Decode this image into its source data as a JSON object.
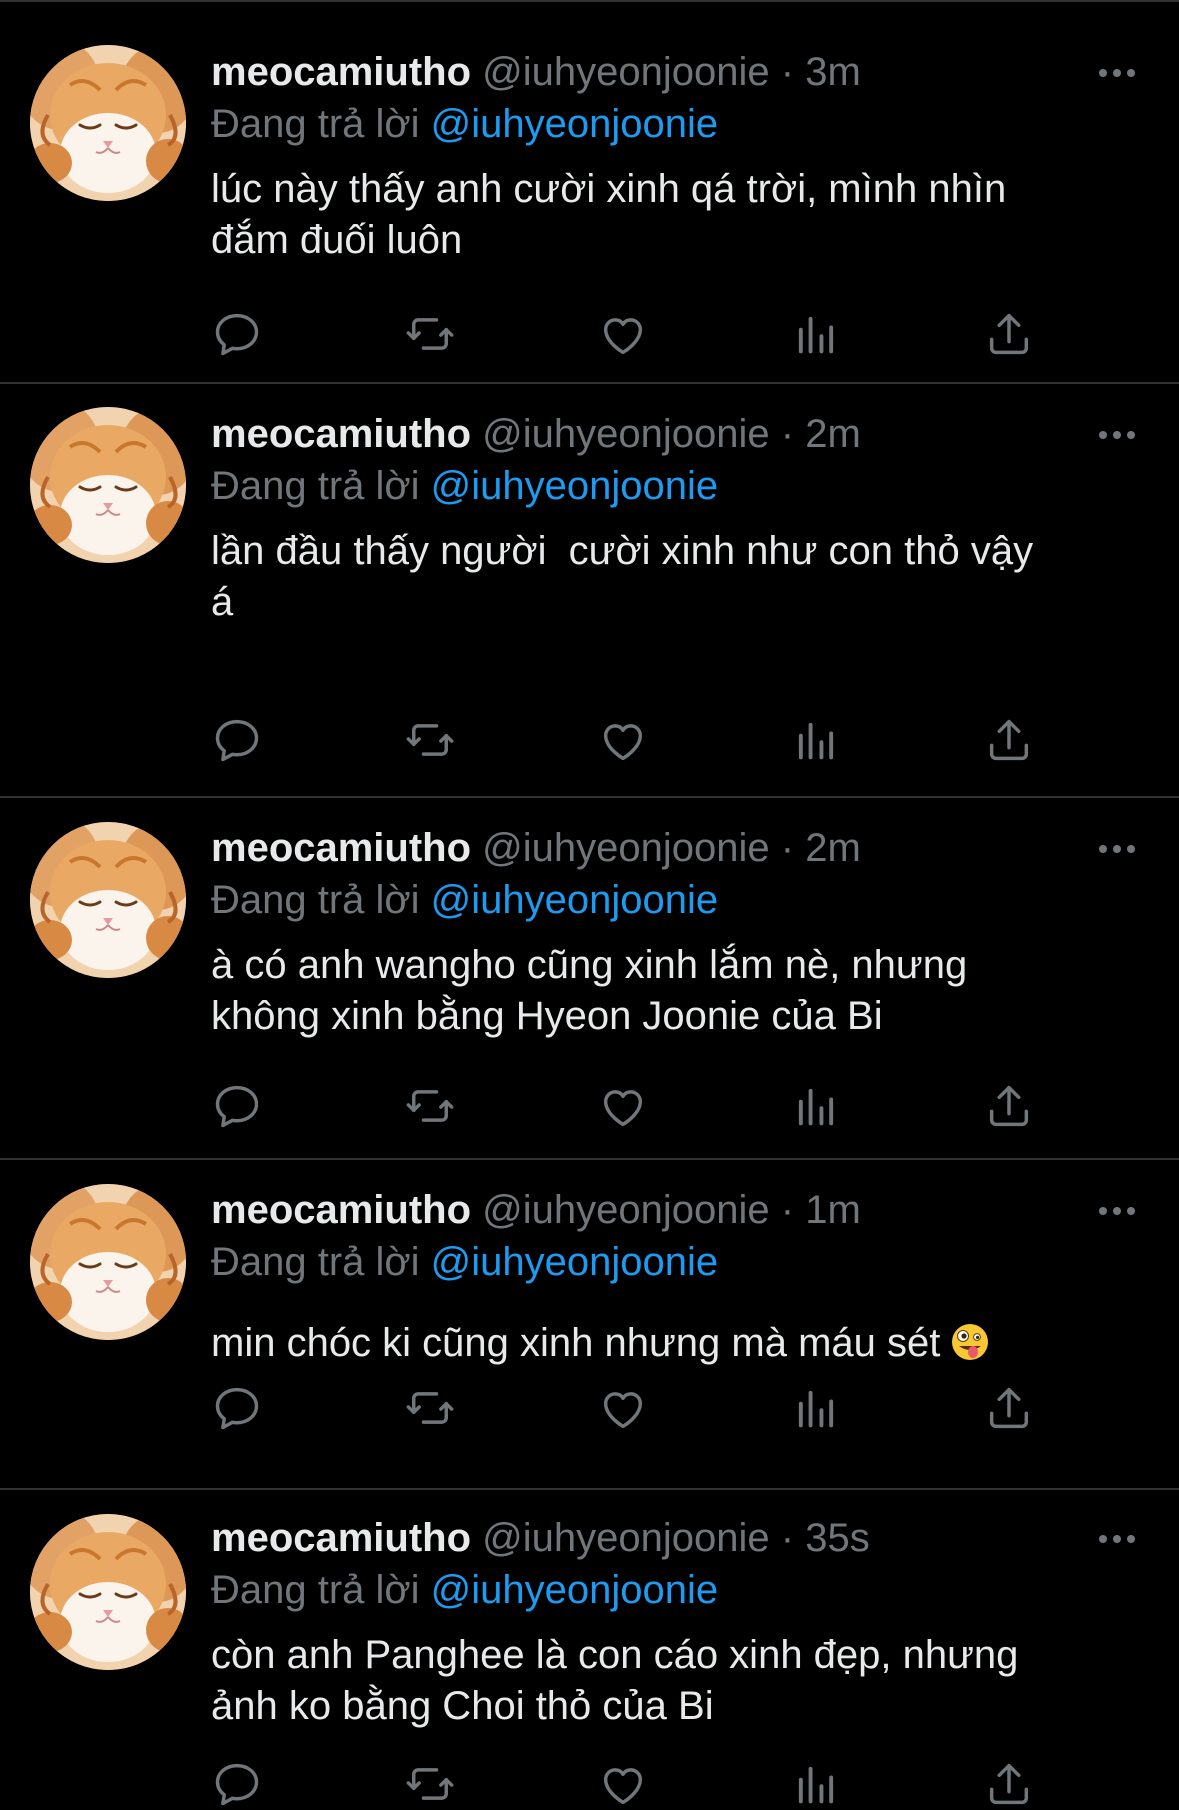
{
  "tweets": [
    {
      "display_name": "meocamiutho",
      "handle": "@iuhyeonjoonie",
      "separator": "·",
      "time": "3m",
      "replying_prefix": "Đang trả lời",
      "replying_to": "@iuhyeonjoonie",
      "text": "lúc này thấy anh cười xinh qá trời, mình nhìn\nđắm đuối luôn"
    },
    {
      "display_name": "meocamiutho",
      "handle": "@iuhyeonjoonie",
      "separator": "·",
      "time": "2m",
      "replying_prefix": "Đang trả lời",
      "replying_to": "@iuhyeonjoonie",
      "text": "lần đầu thấy người  cười xinh như con thỏ vậy\ná"
    },
    {
      "display_name": "meocamiutho",
      "handle": "@iuhyeonjoonie",
      "separator": "·",
      "time": "2m",
      "replying_prefix": "Đang trả lời",
      "replying_to": "@iuhyeonjoonie",
      "text": "à có anh wangho cũng xinh lắm nè, nhưng\nkhông xinh bằng Hyeon Joonie của Bi"
    },
    {
      "display_name": "meocamiutho",
      "handle": "@iuhyeonjoonie",
      "separator": "·",
      "time": "1m",
      "replying_prefix": "Đang trả lời",
      "replying_to": "@iuhyeonjoonie",
      "text": "min chóc ki cũng xinh nhưng mà máu sét",
      "emoji": "zany-face-emoji"
    },
    {
      "display_name": "meocamiutho",
      "handle": "@iuhyeonjoonie",
      "separator": "·",
      "time": "35s",
      "replying_prefix": "Đang trả lời",
      "replying_to": "@iuhyeonjoonie",
      "text": "còn anh Panghee là con cáo xinh đẹp, nhưng\nảnh ko bằng Choi thỏ của Bi"
    }
  ],
  "action_icons": [
    "reply-icon",
    "retweet-icon",
    "like-icon",
    "analytics-icon",
    "share-icon"
  ],
  "colors": {
    "background": "#000000",
    "text": "#e7e9ea",
    "secondary": "#71767b",
    "link": "#1d9bf0",
    "divider": "#2f3336"
  }
}
